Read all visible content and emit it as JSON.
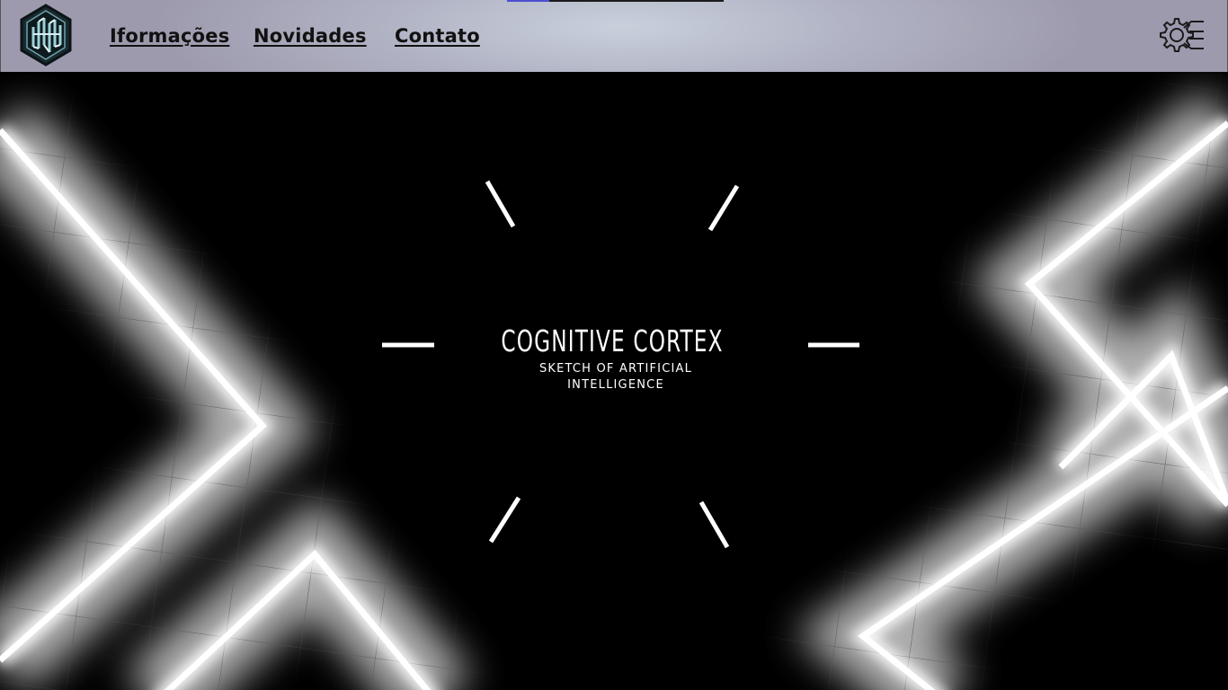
{
  "header": {
    "logo_icon": "hexagon-logo-icon",
    "nav": [
      {
        "label": "Iformações"
      },
      {
        "label": "Novidades"
      },
      {
        "label": "Contato"
      }
    ],
    "settings_icon": "gear-circuit-icon"
  },
  "hero": {
    "title": "COGNITIVE CORTEX",
    "subtitle": "SKETCH OF ARTIFICIAL INTELLIGENCE",
    "background": "glowing-neon-lines-on-grid",
    "accent_color": "#ffffff"
  },
  "colors": {
    "header_gradient_center": "#c9d0dc",
    "header_gradient_edge": "#9d9aad",
    "nav_text": "#111111",
    "hero_background": "#000000",
    "strip_accent": "#4b4fd0"
  }
}
